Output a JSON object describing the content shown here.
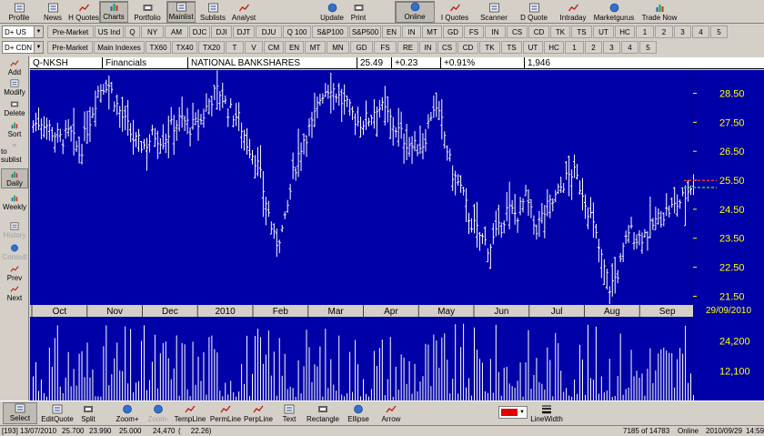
{
  "toolbar": {
    "left": [
      {
        "label": "Profile",
        "icon": "profile-icon",
        "pressed": false
      },
      {
        "label": "News",
        "icon": "news-icon",
        "pressed": false
      },
      {
        "label": "H Quotes",
        "icon": "history-quotes-icon",
        "pressed": false
      },
      {
        "label": "Charts",
        "icon": "charts-icon",
        "pressed": true
      },
      {
        "label": "Portfolio",
        "icon": "portfolio-icon",
        "pressed": false
      },
      {
        "label": "Mainlist",
        "icon": "mainlist-icon",
        "pressed": true
      },
      {
        "label": "Sublists",
        "icon": "sublists-icon",
        "pressed": false
      },
      {
        "label": "Analyst",
        "icon": "analyst-icon",
        "pressed": false
      }
    ],
    "right": [
      {
        "label": "Update",
        "icon": "update-icon",
        "pressed": false
      },
      {
        "label": "Print",
        "icon": "print-icon",
        "pressed": false
      },
      {
        "label": "Online",
        "icon": "online-icon",
        "pressed": true
      },
      {
        "label": "I Quotes",
        "icon": "intraday-quotes-icon",
        "pressed": false
      },
      {
        "label": "Scanner",
        "icon": "scanner-icon",
        "pressed": false
      },
      {
        "label": "D Quote",
        "icon": "d-quote-icon",
        "pressed": false
      },
      {
        "label": "Intraday",
        "icon": "intraday-icon",
        "pressed": false
      },
      {
        "label": "Marketgurus",
        "icon": "marketgurus-icon",
        "pressed": false
      },
      {
        "label": "Trade Now",
        "icon": "trade-now-icon",
        "pressed": false
      }
    ]
  },
  "symbol_rows": [
    {
      "combo": "D+ US",
      "items": [
        "Pre-Market",
        "US Ind",
        "Q",
        "NY",
        "AM",
        "DJC",
        "DJI",
        "DJT",
        "DJU",
        "Q 100",
        "S&P100",
        "S&P500",
        "EN",
        "IN",
        "MT",
        "GD",
        "FS",
        "IN",
        "CS",
        "CD",
        "TK",
        "TS",
        "UT",
        "HC",
        "1",
        "2",
        "3",
        "4",
        "5"
      ]
    },
    {
      "combo": "D+ CDN",
      "items": [
        "Pre-Market",
        "Main Indexes",
        "TX60",
        "TX40",
        "TX20",
        "T",
        "V",
        "CM",
        "EN",
        "MT",
        "MN",
        "GD",
        "FS",
        "RE",
        "IN",
        "CS",
        "CD",
        "TK",
        "TS",
        "UT",
        "HC",
        "1",
        "2",
        "3",
        "4",
        "5"
      ]
    }
  ],
  "sidebar": [
    {
      "label": "Add",
      "icon": "add-down-arrow-icon",
      "state": "normal"
    },
    {
      "label": "Modify",
      "icon": "modify-icon",
      "state": "normal"
    },
    {
      "label": "Delete",
      "icon": "delete-x-icon",
      "state": "normal"
    },
    {
      "label": "Sort",
      "icon": "sort-icon",
      "state": "normal"
    },
    {
      "label": "to sublist",
      "icon": "to-sublist-icon",
      "state": "normal"
    },
    {
      "label": "Daily",
      "icon": "daily-icon",
      "state": "pressed"
    },
    {
      "label": "Weekly",
      "icon": "weekly-icon",
      "state": "normal"
    },
    {
      "label": "History",
      "icon": "history-icon",
      "state": "disabled"
    },
    {
      "label": "Consult",
      "icon": "consult-icon",
      "state": "disabled"
    },
    {
      "label": "Prev",
      "icon": "prev-up-arrow-icon",
      "state": "normal"
    },
    {
      "label": "Next",
      "icon": "next-down-arrow-icon",
      "state": "normal"
    }
  ],
  "chart_header": {
    "symbol": "Q-NKSH",
    "sector": "Financials",
    "name": "NATIONAL BANKSHARES",
    "last": "25.49",
    "change": "+0.23",
    "change_pct": "+0.91%",
    "volume": "1,946"
  },
  "date_badge": "29/09/2010",
  "colors": {
    "panel_bg": "#0000a8",
    "bars": "#ffffff",
    "axis_text": "#ffff00",
    "last_price_line": "#ff3030",
    "average_line": "#30d030",
    "ui_face": "#d4d0c8"
  },
  "chart_data": {
    "type": "ohlc",
    "title": "Q-NKSH NATIONAL BANKSHARES",
    "price_axis_ticks": [
      "28.50",
      "27.50",
      "26.50",
      "25.50",
      "24.50",
      "23.50",
      "22.50",
      "21.50"
    ],
    "price_ylim": [
      21.2,
      29.3
    ],
    "volume_axis_ticks": [
      "24,200",
      "12,100"
    ],
    "volume_ylim": [
      0,
      34000
    ],
    "x_labels": [
      "Oct",
      "Nov",
      "Dec",
      "2010",
      "Feb",
      "Mar",
      "Apr",
      "May",
      "Jun",
      "Jul",
      "Aug",
      "Sep"
    ],
    "last_close": 25.49,
    "reference_line": 25.25,
    "close_series": [
      {
        "month": "Oct",
        "closes": [
          27.4,
          27.6,
          27.2,
          26.9,
          27.1,
          26.4
        ]
      },
      {
        "month": "Nov",
        "closes": [
          27.5,
          28.6,
          28.9,
          28.1,
          27.4,
          26.8
        ]
      },
      {
        "month": "Dec",
        "closes": [
          26.7,
          27.1,
          26.9,
          27.4,
          27.6,
          27.3
        ]
      },
      {
        "month": "2010",
        "closes": [
          27.5,
          28.3,
          28.6,
          27.9,
          27.7,
          26.8
        ]
      },
      {
        "month": "Feb",
        "closes": [
          26.2,
          24.8,
          23.3,
          23.9,
          25.8,
          26.9
        ]
      },
      {
        "month": "Mar",
        "closes": [
          27.4,
          28.5,
          28.8,
          28.3,
          27.9,
          27.5
        ]
      },
      {
        "month": "Apr",
        "closes": [
          27.6,
          28.1,
          27.8,
          27.3,
          26.9,
          26.6
        ]
      },
      {
        "month": "May",
        "closes": [
          26.8,
          28.1,
          27.4,
          25.8,
          25.2,
          24.1
        ]
      },
      {
        "month": "Jun",
        "closes": [
          23.6,
          23.2,
          23.7,
          24.5,
          24.3,
          24.9
        ]
      },
      {
        "month": "Jul",
        "closes": [
          23.8,
          24.4,
          24.8,
          25.4,
          25.8,
          25.2
        ]
      },
      {
        "month": "Aug",
        "closes": [
          24.2,
          22.9,
          21.8,
          22.4,
          23.8,
          23.5
        ]
      },
      {
        "month": "Sep",
        "closes": [
          23.7,
          24.1,
          24.4,
          24.6,
          24.9,
          25.49
        ]
      }
    ]
  },
  "drawbar": [
    {
      "label": "Select",
      "icon": "select-cursor-icon",
      "state": "pressed"
    },
    {
      "label": "EditQuote",
      "icon": "edit-quote-icon",
      "state": "normal"
    },
    {
      "label": "Split",
      "icon": "split-icon",
      "state": "normal"
    },
    {
      "label": "Zoom+",
      "icon": "zoom-in-icon",
      "state": "normal"
    },
    {
      "label": "Zoom-",
      "icon": "zoom-out-icon",
      "state": "disabled"
    },
    {
      "label": "TempLine",
      "icon": "temp-line-icon",
      "state": "normal"
    },
    {
      "label": "PermLine",
      "icon": "perm-line-icon",
      "state": "normal"
    },
    {
      "label": "PerpLine",
      "icon": "perp-line-icon",
      "state": "normal"
    },
    {
      "label": "Text",
      "icon": "text-t-icon",
      "state": "normal"
    },
    {
      "label": "Rectangle",
      "icon": "rectangle-icon",
      "state": "normal"
    },
    {
      "label": "Ellipse",
      "icon": "ellipse-icon",
      "state": "normal"
    },
    {
      "label": "Arrow",
      "icon": "arrow-icon",
      "state": "normal"
    }
  ],
  "linewidth_label": "LineWidth",
  "color_picker": "#e00000",
  "status": {
    "cursor_info": "[193] 13/07/2010",
    "val1": "25.700",
    "val2": "23.990",
    "val3": "25.000",
    "val4": "24,470",
    "val5": "(     22.26)",
    "record": "7185 of 14783",
    "mode": "Online",
    "date": "2010/09/29",
    "time": "14:59"
  }
}
